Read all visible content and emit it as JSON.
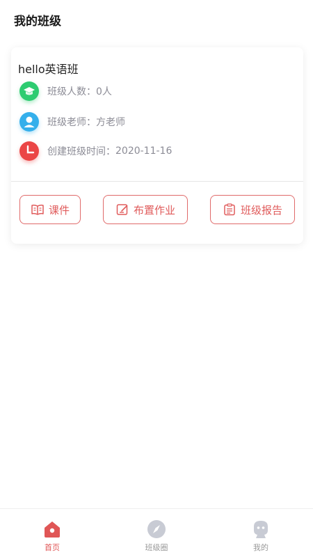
{
  "header": {
    "title": "我的班级"
  },
  "class_card": {
    "name": "hello英语班",
    "member_count": {
      "label": "班级人数：",
      "value": "0人",
      "icon": "graduation-cap-icon"
    },
    "teacher": {
      "label": "班级老师：",
      "value": "方老师",
      "icon": "teacher-avatar-icon"
    },
    "created": {
      "label": "创建班级时间：",
      "value": "2020-11-16",
      "icon": "clock-icon"
    }
  },
  "actions": [
    {
      "label": "课件",
      "icon": "book-icon"
    },
    {
      "label": "布置作业",
      "icon": "edit-icon"
    },
    {
      "label": "班级报告",
      "icon": "clipboard-icon"
    }
  ],
  "tabbar": {
    "items": [
      {
        "label": "首页",
        "icon": "home-icon",
        "active": true
      },
      {
        "label": "班级圈",
        "icon": "compass-icon",
        "active": false
      },
      {
        "label": "我的",
        "icon": "profile-icon",
        "active": false
      }
    ]
  },
  "colors": {
    "accent": "#e05656",
    "green_icon": "#2ecc71",
    "blue_icon": "#34afeb",
    "red_icon": "#eb4646",
    "inactive_tab": "#c8cbd4"
  }
}
